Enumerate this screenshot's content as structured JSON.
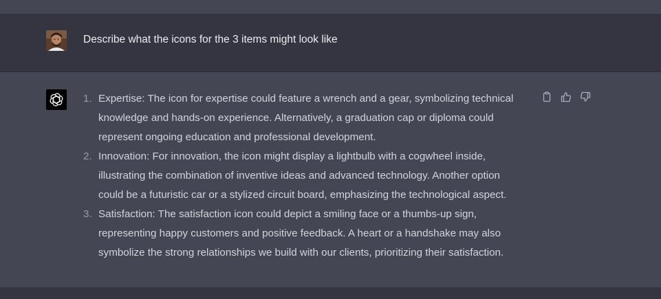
{
  "colors": {
    "page_bg": "#343541",
    "assistant_bg": "#444654",
    "user_text": "#ececf1",
    "assistant_text": "#d1d5db",
    "number_text": "#9a9ba6",
    "icon_color": "#acacbe"
  },
  "user_message": {
    "avatar": "user-photo-avatar",
    "text": "Describe what the icons for the 3 items might look like"
  },
  "assistant_message": {
    "avatar": "chatgpt-logo-icon",
    "items": [
      {
        "number": "1.",
        "lines": [
          "Expertise: The icon for expertise could feature a wrench and a gear, symbolizing technical",
          "knowledge and hands-on experience. Alternatively, a graduation cap or diploma could",
          "represent ongoing education and professional development."
        ]
      },
      {
        "number": "2.",
        "lines": [
          "Innovation: For innovation, the icon might display a lightbulb with a cogwheel inside,",
          "illustrating the combination of inventive ideas and advanced technology. Another option",
          "could be a futuristic car or a stylized circuit board, emphasizing the technological aspect."
        ]
      },
      {
        "number": "3.",
        "lines": [
          "Satisfaction: The satisfaction icon could depict a smiling face or a thumbs-up sign,",
          "representing happy customers and positive feedback. A heart or a handshake may also",
          "symbolize the strong relationships we build with our clients, prioritizing their satisfaction."
        ]
      }
    ],
    "actions": [
      "copy-icon",
      "thumbs-up-icon",
      "thumbs-down-icon"
    ]
  }
}
